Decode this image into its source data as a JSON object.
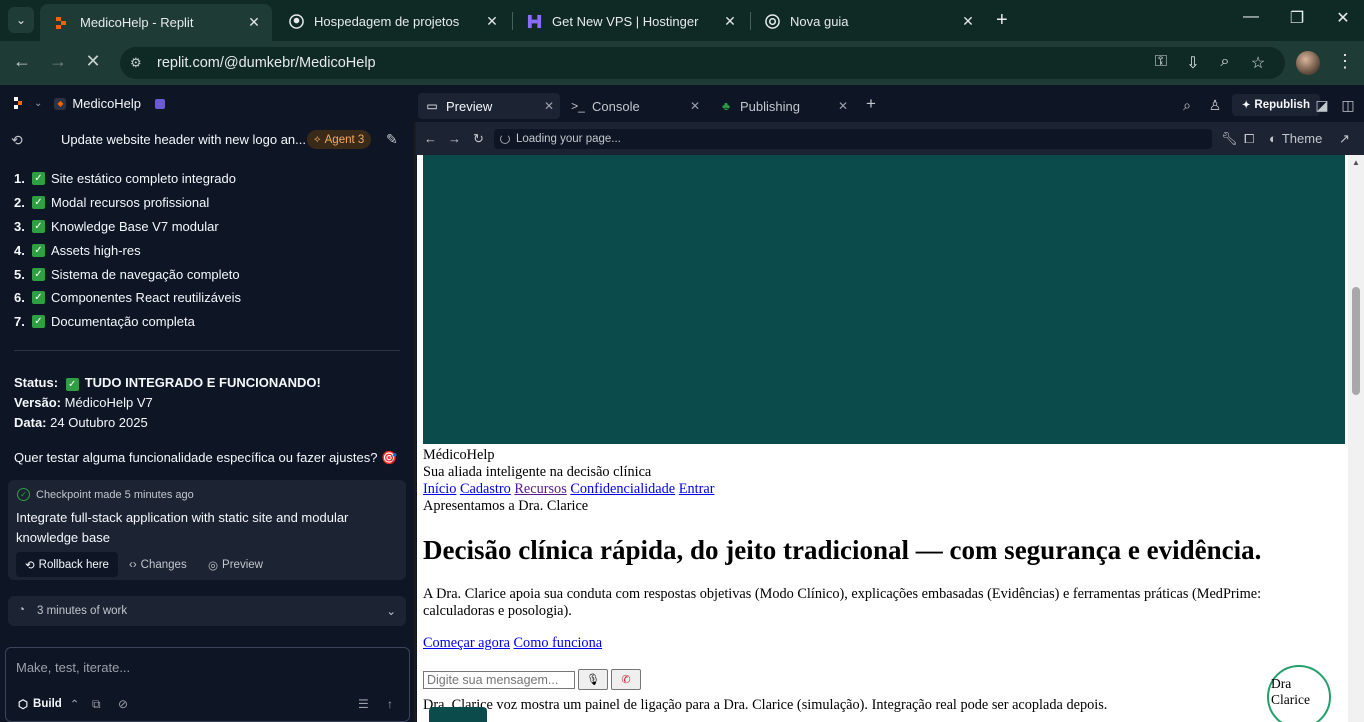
{
  "browser": {
    "tabs": [
      {
        "title": "MedicoHelp - Replit",
        "icon": "replit-icon",
        "active": true
      },
      {
        "title": "Hospedagem de projetos",
        "icon": "github-icon",
        "active": false
      },
      {
        "title": "Get New VPS | Hostinger",
        "icon": "hostinger-icon",
        "active": false
      },
      {
        "title": "Nova guia",
        "icon": "chrome-icon",
        "active": false
      }
    ],
    "url": "replit.com/@dumkebr/MedicoHelp"
  },
  "replit": {
    "project_name": "MedicoHelp",
    "pane_tabs": [
      "Preview",
      "Console",
      "Publishing"
    ],
    "republish_label": "Republish"
  },
  "chat": {
    "thread_title": "Update website header with new logo an...",
    "agent_badge": "Agent 3",
    "checklist": [
      {
        "num": "1.",
        "text": "Site estático completo integrado"
      },
      {
        "num": "2.",
        "text": "Modal recursos profissional"
      },
      {
        "num": "3.",
        "text": "Knowledge Base V7 modular"
      },
      {
        "num": "4.",
        "text": "Assets high-res"
      },
      {
        "num": "5.",
        "text": "Sistema de navegação completo"
      },
      {
        "num": "6.",
        "text": "Componentes React reutilizáveis"
      },
      {
        "num": "7.",
        "text": "Documentação completa"
      }
    ],
    "status_label": "Status:",
    "status_value": "TUDO INTEGRADO E FUNCIONANDO!",
    "version_label": "Versão:",
    "version_value": "MédicoHelp V7",
    "date_label": "Data:",
    "date_value": "24 Outubro 2025",
    "question": "Quer testar alguma funcionalidade específica ou fazer ajustes? 🎯",
    "checkpoint": {
      "header": "Checkpoint made 5 minutes ago",
      "title": "Integrate full-stack application with static site and modular knowledge base",
      "rollback_label": "Rollback here",
      "changes_label": "Changes",
      "preview_label": "Preview"
    },
    "work_summary": "3 minutes of work",
    "composer_placeholder": "Make, test, iterate...",
    "build_label": "Build"
  },
  "preview": {
    "loading_text": "Loading your page...",
    "theme_label": "Theme",
    "site": {
      "brand": "MédicoHelp",
      "tagline": "Sua aliada inteligente na decisão clínica",
      "nav": [
        "Início",
        "Cadastro",
        "Recursos",
        "Confidencialidade",
        "Entrar"
      ],
      "intro": "Apresentamos a Dra. Clarice",
      "headline": "Decisão clínica rápida, do jeito tradicional — com segurança e evidência.",
      "description": "A Dra. Clarice apoia sua conduta com respostas objetivas (Modo Clínico), explicações embasadas (Evidências) e ferramentas práticas (MedPrime: calculadoras e posologia).",
      "cta_primary": "Começar agora",
      "cta_secondary": "Como funciona",
      "message_placeholder": "Digite sua mensagem...",
      "footnote": "Dra. Clarice voz mostra um painel de ligação para a Dra. Clarice (simulação). Integração real pode ser acoplada depois.",
      "avatar_label": "Dra Clarice"
    }
  },
  "colors": {
    "browser_dark": "#0f2a24",
    "replit_bg": "#0e1525",
    "hero_teal": "#0b4b4b",
    "agent_orange": "#f9a95c",
    "check_green": "#2ea043"
  }
}
